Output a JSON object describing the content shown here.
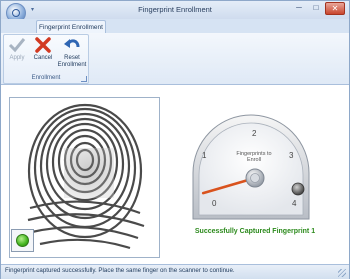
{
  "window": {
    "title": "Fingerprint Enrollment",
    "minimize": "─",
    "maximize": "□",
    "close": "✕"
  },
  "ribbon": {
    "tab": "Fingerprint Enrollment",
    "group_label": "Enrollment",
    "buttons": {
      "apply": "Apply",
      "cancel": "Cancel",
      "reset_line1": "Reset",
      "reset_line2": "Enrollment"
    }
  },
  "gauge": {
    "caption_line1": "Fingerprints to",
    "caption_line2": "Enroll",
    "ticks": [
      "0",
      "1",
      "2",
      "3",
      "4"
    ],
    "value": 0.3,
    "min": 0,
    "max": 4
  },
  "status": {
    "message": "Successfully Captured Fingerprint 1",
    "bar": "Fingerprint captured successfully. Place the same finger on the scanner to continue."
  },
  "colors": {
    "needle": "#d9531e",
    "success": "#2c8a1c",
    "led": "#43b51f"
  }
}
